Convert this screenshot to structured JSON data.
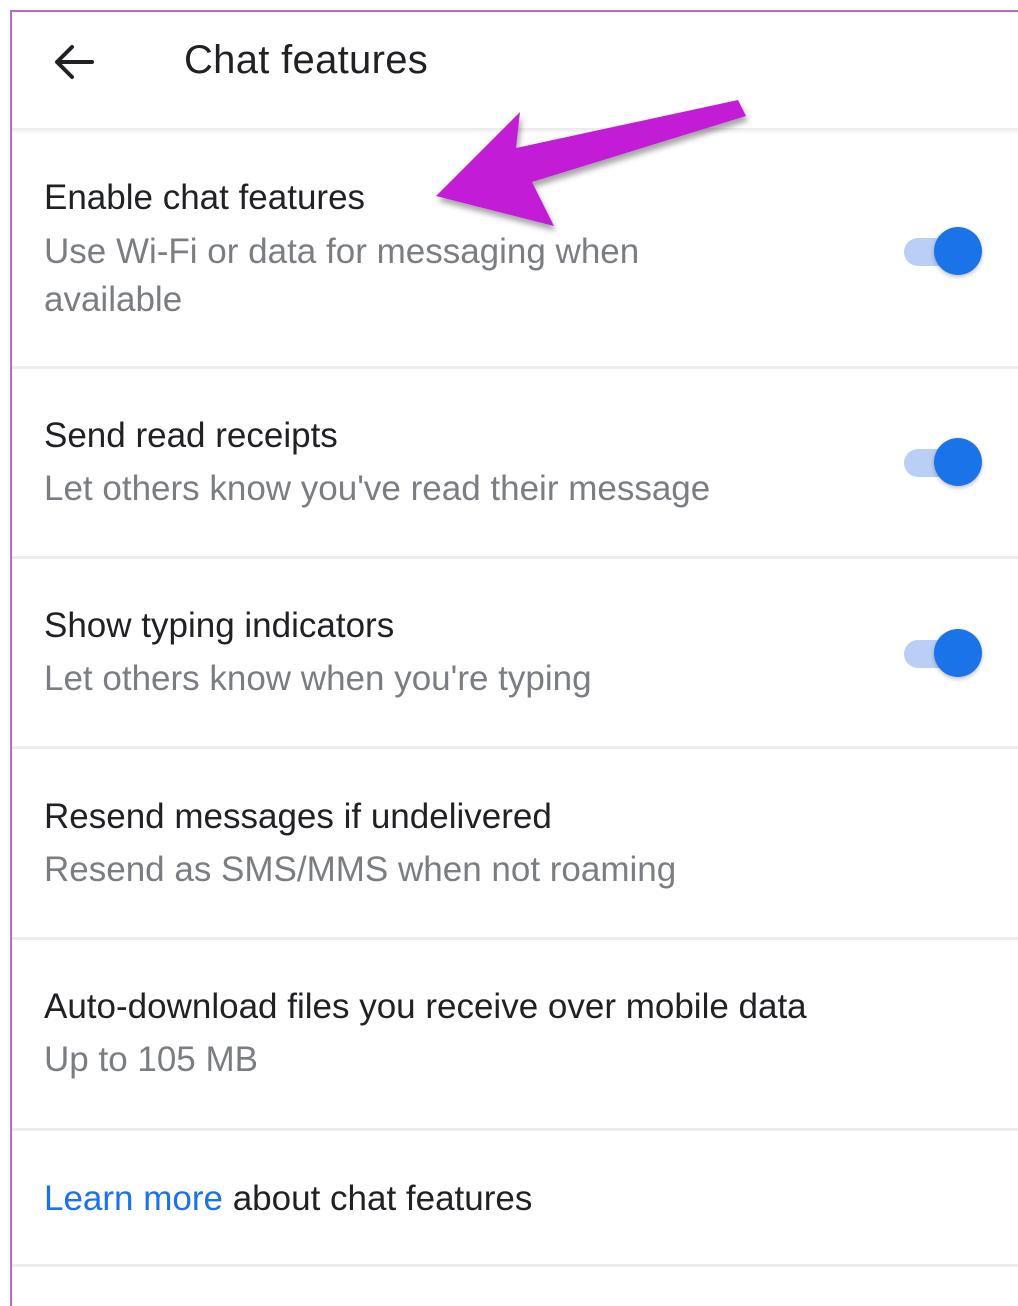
{
  "appbar": {
    "title": "Chat features",
    "back_icon": "arrow-back-icon"
  },
  "settings": [
    {
      "title": "Enable chat features",
      "subtitle": "Use Wi-Fi or data for messaging when available",
      "toggle": true
    },
    {
      "title": "Send read receipts",
      "subtitle": "Let others know you've read their message",
      "toggle": true
    },
    {
      "title": "Show typing indicators",
      "subtitle": "Let others know when you're typing",
      "toggle": true
    },
    {
      "title": "Resend messages if undelivered",
      "subtitle": "Resend as SMS/MMS when not roaming",
      "toggle": null
    },
    {
      "title": "Auto-download files you receive over mobile data",
      "subtitle": "Up to 105 MB",
      "toggle": null
    }
  ],
  "footer": {
    "link_text": "Learn more",
    "rest_text": " about chat features"
  },
  "annotation": {
    "arrow_icon": "purple-arrow-icon"
  },
  "colors": {
    "accent": "#1a73e8",
    "toggle_track": "#b9cff5",
    "annotation_arrow": "#c21fd6",
    "title_text": "#202124",
    "subtitle_text": "#7a7d82"
  }
}
